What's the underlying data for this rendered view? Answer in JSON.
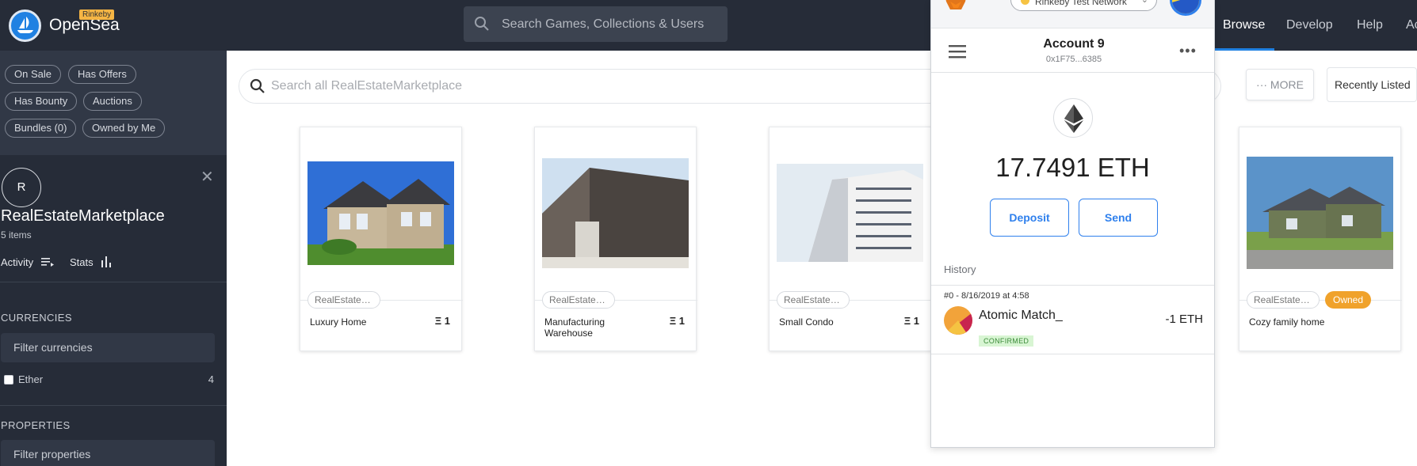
{
  "header": {
    "brand": "OpenSea",
    "network_badge": "Rinkeby",
    "search_placeholder": "Search Games, Collections & Users",
    "nav": [
      "Browse",
      "Develop",
      "Help",
      "Ac"
    ]
  },
  "sidebar": {
    "filter_chips": [
      "On Sale",
      "Has Offers",
      "Has Bounty",
      "Auctions",
      "Bundles (0)",
      "Owned by Me"
    ],
    "collection": {
      "avatar_letter": "R",
      "name": "RealEstateMarketplace",
      "count": "5 items",
      "activity_label": "Activity",
      "stats_label": "Stats"
    },
    "currencies": {
      "heading": "CURRENCIES",
      "filter_placeholder": "Filter currencies",
      "items": [
        {
          "label": "Ether",
          "count": "4"
        }
      ]
    },
    "properties": {
      "heading": "PROPERTIES",
      "filter_placeholder": "Filter properties"
    }
  },
  "main": {
    "search_placeholder": "Search all RealEstateMarketplace",
    "more_label": "··· MORE",
    "sort_label": "Recently Listed",
    "cards": [
      {
        "collection": "RealEstate…",
        "title": "Luxury Home",
        "qty": "Ξ 1",
        "owned": ""
      },
      {
        "collection": "RealEstate…",
        "title": "Manufacturing Warehouse",
        "qty": "Ξ 1",
        "owned": ""
      },
      {
        "collection": "RealEstate…",
        "title": "Small Condo",
        "qty": "Ξ 1",
        "owned": ""
      },
      {
        "collection": "RealEstate…",
        "title": "Cozy family home",
        "qty": "",
        "owned": "Owned"
      }
    ]
  },
  "wallet": {
    "network": "Rinkeby Test Network",
    "account_name": "Account 9",
    "address": "0x1F75...6385",
    "balance": "17.7491 ETH",
    "deposit_label": "Deposit",
    "send_label": "Send",
    "history_label": "History",
    "transactions": [
      {
        "date": "#0 - 8/16/2019 at 4:58",
        "name": "Atomic Match_",
        "status": "CONFIRMED",
        "amount": "-1 ETH"
      }
    ]
  },
  "colors": {
    "navbar": "#262c38",
    "accent": "#2081e2",
    "owned_badge": "#f0a22b",
    "metamask_blue": "#2f80ed"
  }
}
